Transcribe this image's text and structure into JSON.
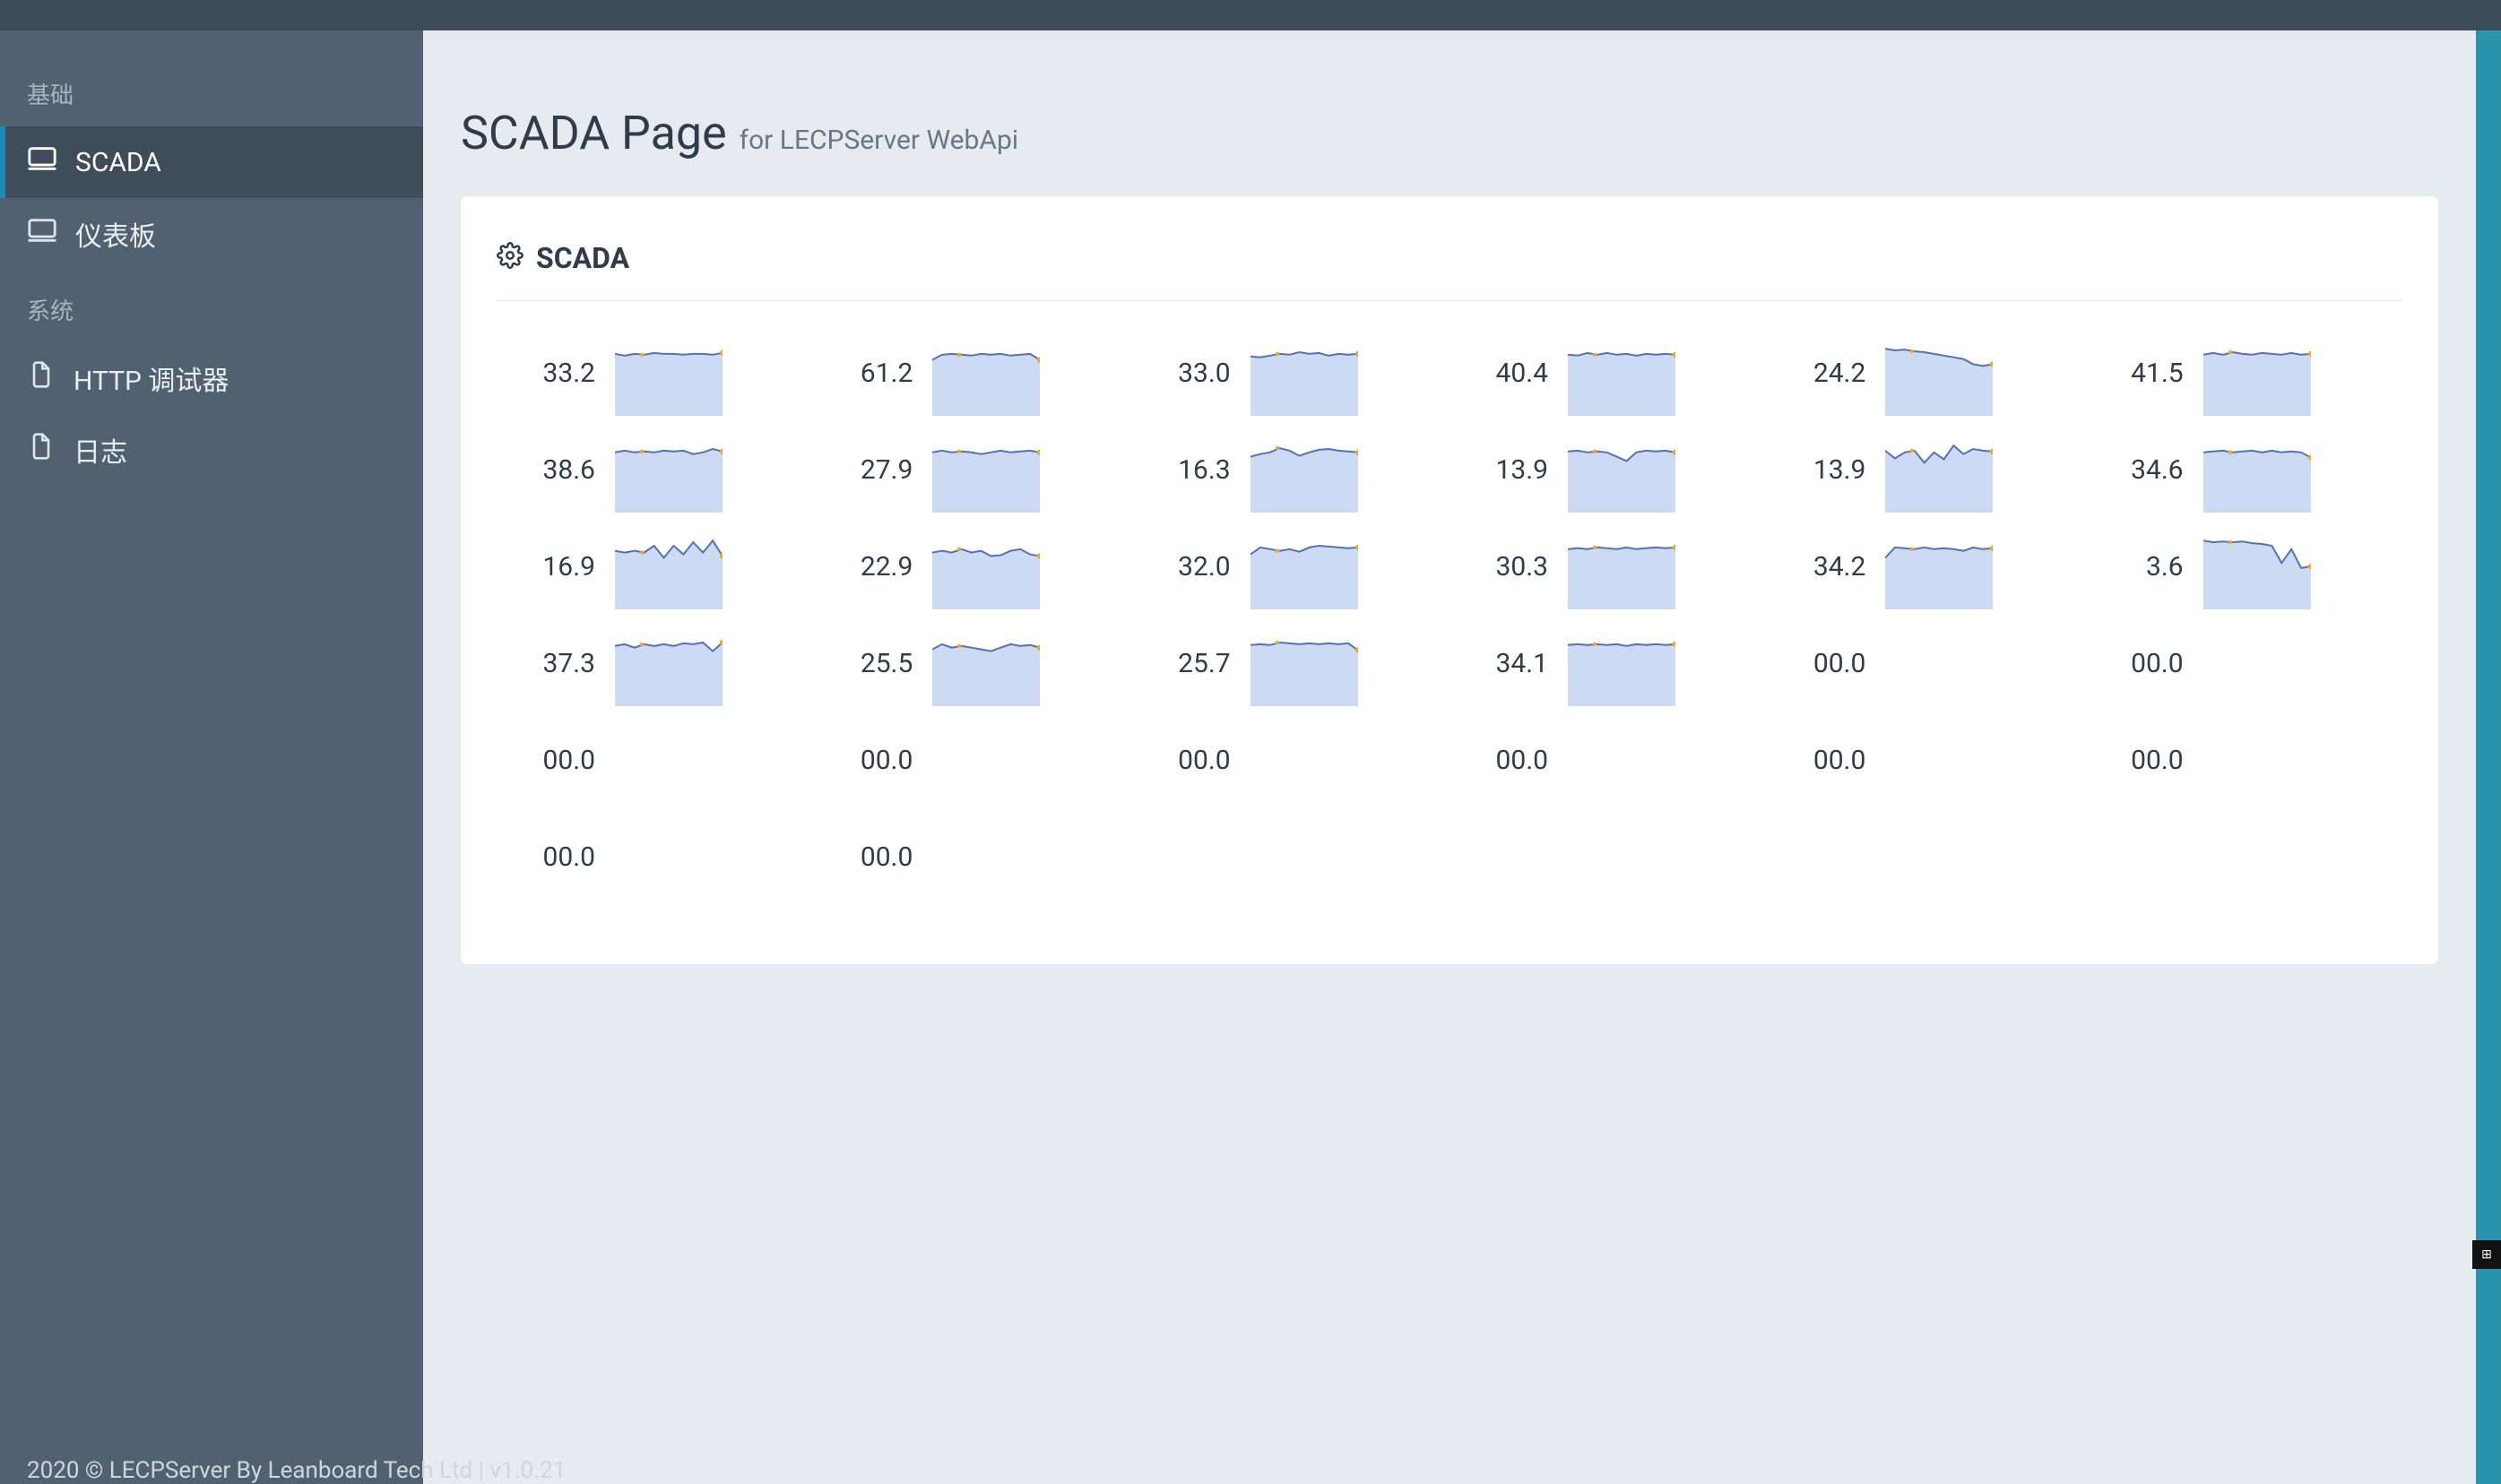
{
  "sidebar": {
    "groups": [
      {
        "label": "基础",
        "items": [
          {
            "label": "SCADA",
            "icon": "monitor",
            "active": true
          },
          {
            "label": "仪表板",
            "icon": "monitor",
            "active": false
          }
        ]
      },
      {
        "label": "系统",
        "items": [
          {
            "label": "HTTP 调试器",
            "icon": "doc",
            "active": false
          },
          {
            "label": "日志",
            "icon": "doc",
            "active": false
          }
        ]
      }
    ]
  },
  "page": {
    "title": "SCADA Page",
    "subtitle": "for LECPServer WebApi"
  },
  "card": {
    "title": "SCADA"
  },
  "scada_tiles": [
    {
      "value": "33.2",
      "spark": [
        0.72,
        0.7,
        0.72,
        0.71,
        0.73,
        0.72,
        0.72,
        0.71,
        0.72,
        0.72,
        0.71,
        0.73
      ]
    },
    {
      "value": "61.2",
      "spark": [
        0.65,
        0.71,
        0.72,
        0.71,
        0.7,
        0.72,
        0.71,
        0.72,
        0.7,
        0.71,
        0.72,
        0.65
      ]
    },
    {
      "value": "33.0",
      "spark": [
        0.69,
        0.68,
        0.7,
        0.72,
        0.71,
        0.74,
        0.72,
        0.73,
        0.7,
        0.72,
        0.71,
        0.72
      ]
    },
    {
      "value": "40.4",
      "spark": [
        0.71,
        0.7,
        0.73,
        0.71,
        0.73,
        0.71,
        0.72,
        0.7,
        0.72,
        0.71,
        0.72,
        0.71
      ]
    },
    {
      "value": "24.2",
      "spark": [
        0.78,
        0.76,
        0.77,
        0.75,
        0.74,
        0.72,
        0.7,
        0.68,
        0.66,
        0.6,
        0.58,
        0.6
      ]
    },
    {
      "value": "41.5",
      "spark": [
        0.71,
        0.73,
        0.71,
        0.74,
        0.72,
        0.71,
        0.73,
        0.72,
        0.71,
        0.73,
        0.71,
        0.72
      ]
    },
    {
      "value": "38.6",
      "spark": [
        0.7,
        0.72,
        0.7,
        0.71,
        0.7,
        0.72,
        0.71,
        0.72,
        0.68,
        0.7,
        0.74,
        0.71
      ]
    },
    {
      "value": "27.9",
      "spark": [
        0.7,
        0.72,
        0.7,
        0.71,
        0.7,
        0.68,
        0.7,
        0.72,
        0.7,
        0.71,
        0.72,
        0.7
      ]
    },
    {
      "value": "16.3",
      "spark": [
        0.65,
        0.68,
        0.7,
        0.75,
        0.72,
        0.66,
        0.7,
        0.73,
        0.74,
        0.72,
        0.71,
        0.7
      ]
    },
    {
      "value": "13.9",
      "spark": [
        0.71,
        0.72,
        0.7,
        0.71,
        0.7,
        0.65,
        0.6,
        0.7,
        0.72,
        0.71,
        0.72,
        0.7
      ]
    },
    {
      "value": "13.9",
      "spark": [
        0.72,
        0.63,
        0.7,
        0.72,
        0.58,
        0.7,
        0.62,
        0.78,
        0.68,
        0.74,
        0.72,
        0.71
      ]
    },
    {
      "value": "34.6",
      "spark": [
        0.7,
        0.71,
        0.72,
        0.7,
        0.71,
        0.72,
        0.7,
        0.72,
        0.7,
        0.71,
        0.7,
        0.64
      ]
    },
    {
      "value": "16.9",
      "spark": [
        0.68,
        0.66,
        0.68,
        0.66,
        0.74,
        0.6,
        0.74,
        0.64,
        0.78,
        0.66,
        0.8,
        0.62
      ]
    },
    {
      "value": "22.9",
      "spark": [
        0.66,
        0.68,
        0.66,
        0.7,
        0.66,
        0.68,
        0.62,
        0.63,
        0.68,
        0.7,
        0.64,
        0.62
      ]
    },
    {
      "value": "32.0",
      "spark": [
        0.64,
        0.72,
        0.7,
        0.68,
        0.7,
        0.67,
        0.72,
        0.74,
        0.73,
        0.72,
        0.71,
        0.72
      ]
    },
    {
      "value": "30.3",
      "spark": [
        0.7,
        0.71,
        0.7,
        0.72,
        0.71,
        0.7,
        0.72,
        0.7,
        0.71,
        0.72,
        0.71,
        0.72
      ]
    },
    {
      "value": "34.2",
      "spark": [
        0.6,
        0.72,
        0.71,
        0.7,
        0.72,
        0.7,
        0.71,
        0.7,
        0.68,
        0.72,
        0.7,
        0.71
      ]
    },
    {
      "value": "3.6",
      "spark": [
        0.8,
        0.78,
        0.79,
        0.78,
        0.79,
        0.77,
        0.76,
        0.74,
        0.54,
        0.7,
        0.48,
        0.5
      ]
    },
    {
      "value": "37.3",
      "spark": [
        0.7,
        0.72,
        0.68,
        0.72,
        0.7,
        0.72,
        0.7,
        0.73,
        0.72,
        0.74,
        0.64,
        0.74
      ]
    },
    {
      "value": "25.5",
      "spark": [
        0.66,
        0.72,
        0.68,
        0.7,
        0.68,
        0.66,
        0.64,
        0.68,
        0.72,
        0.7,
        0.71,
        0.68
      ]
    },
    {
      "value": "25.7",
      "spark": [
        0.71,
        0.72,
        0.71,
        0.74,
        0.73,
        0.72,
        0.73,
        0.72,
        0.73,
        0.72,
        0.73,
        0.65
      ]
    },
    {
      "value": "34.1",
      "spark": [
        0.71,
        0.72,
        0.71,
        0.72,
        0.71,
        0.72,
        0.7,
        0.72,
        0.71,
        0.72,
        0.71,
        0.72
      ]
    },
    {
      "value": "00.0"
    },
    {
      "value": "00.0"
    },
    {
      "value": "00.0"
    },
    {
      "value": "00.0"
    },
    {
      "value": "00.0"
    },
    {
      "value": "00.0"
    },
    {
      "value": "00.0"
    },
    {
      "value": "00.0"
    },
    {
      "value": "00.0"
    },
    {
      "value": "00.0"
    }
  ],
  "footer": {
    "copyright": "2020 © LECPServer By Leanboard Tech Ltd",
    "divider": " | ",
    "version": "v1.0.21"
  },
  "colors": {
    "spark_fill": "#ccdaf4",
    "spark_line": "#5670b6",
    "spark_point": "#f5a623"
  }
}
